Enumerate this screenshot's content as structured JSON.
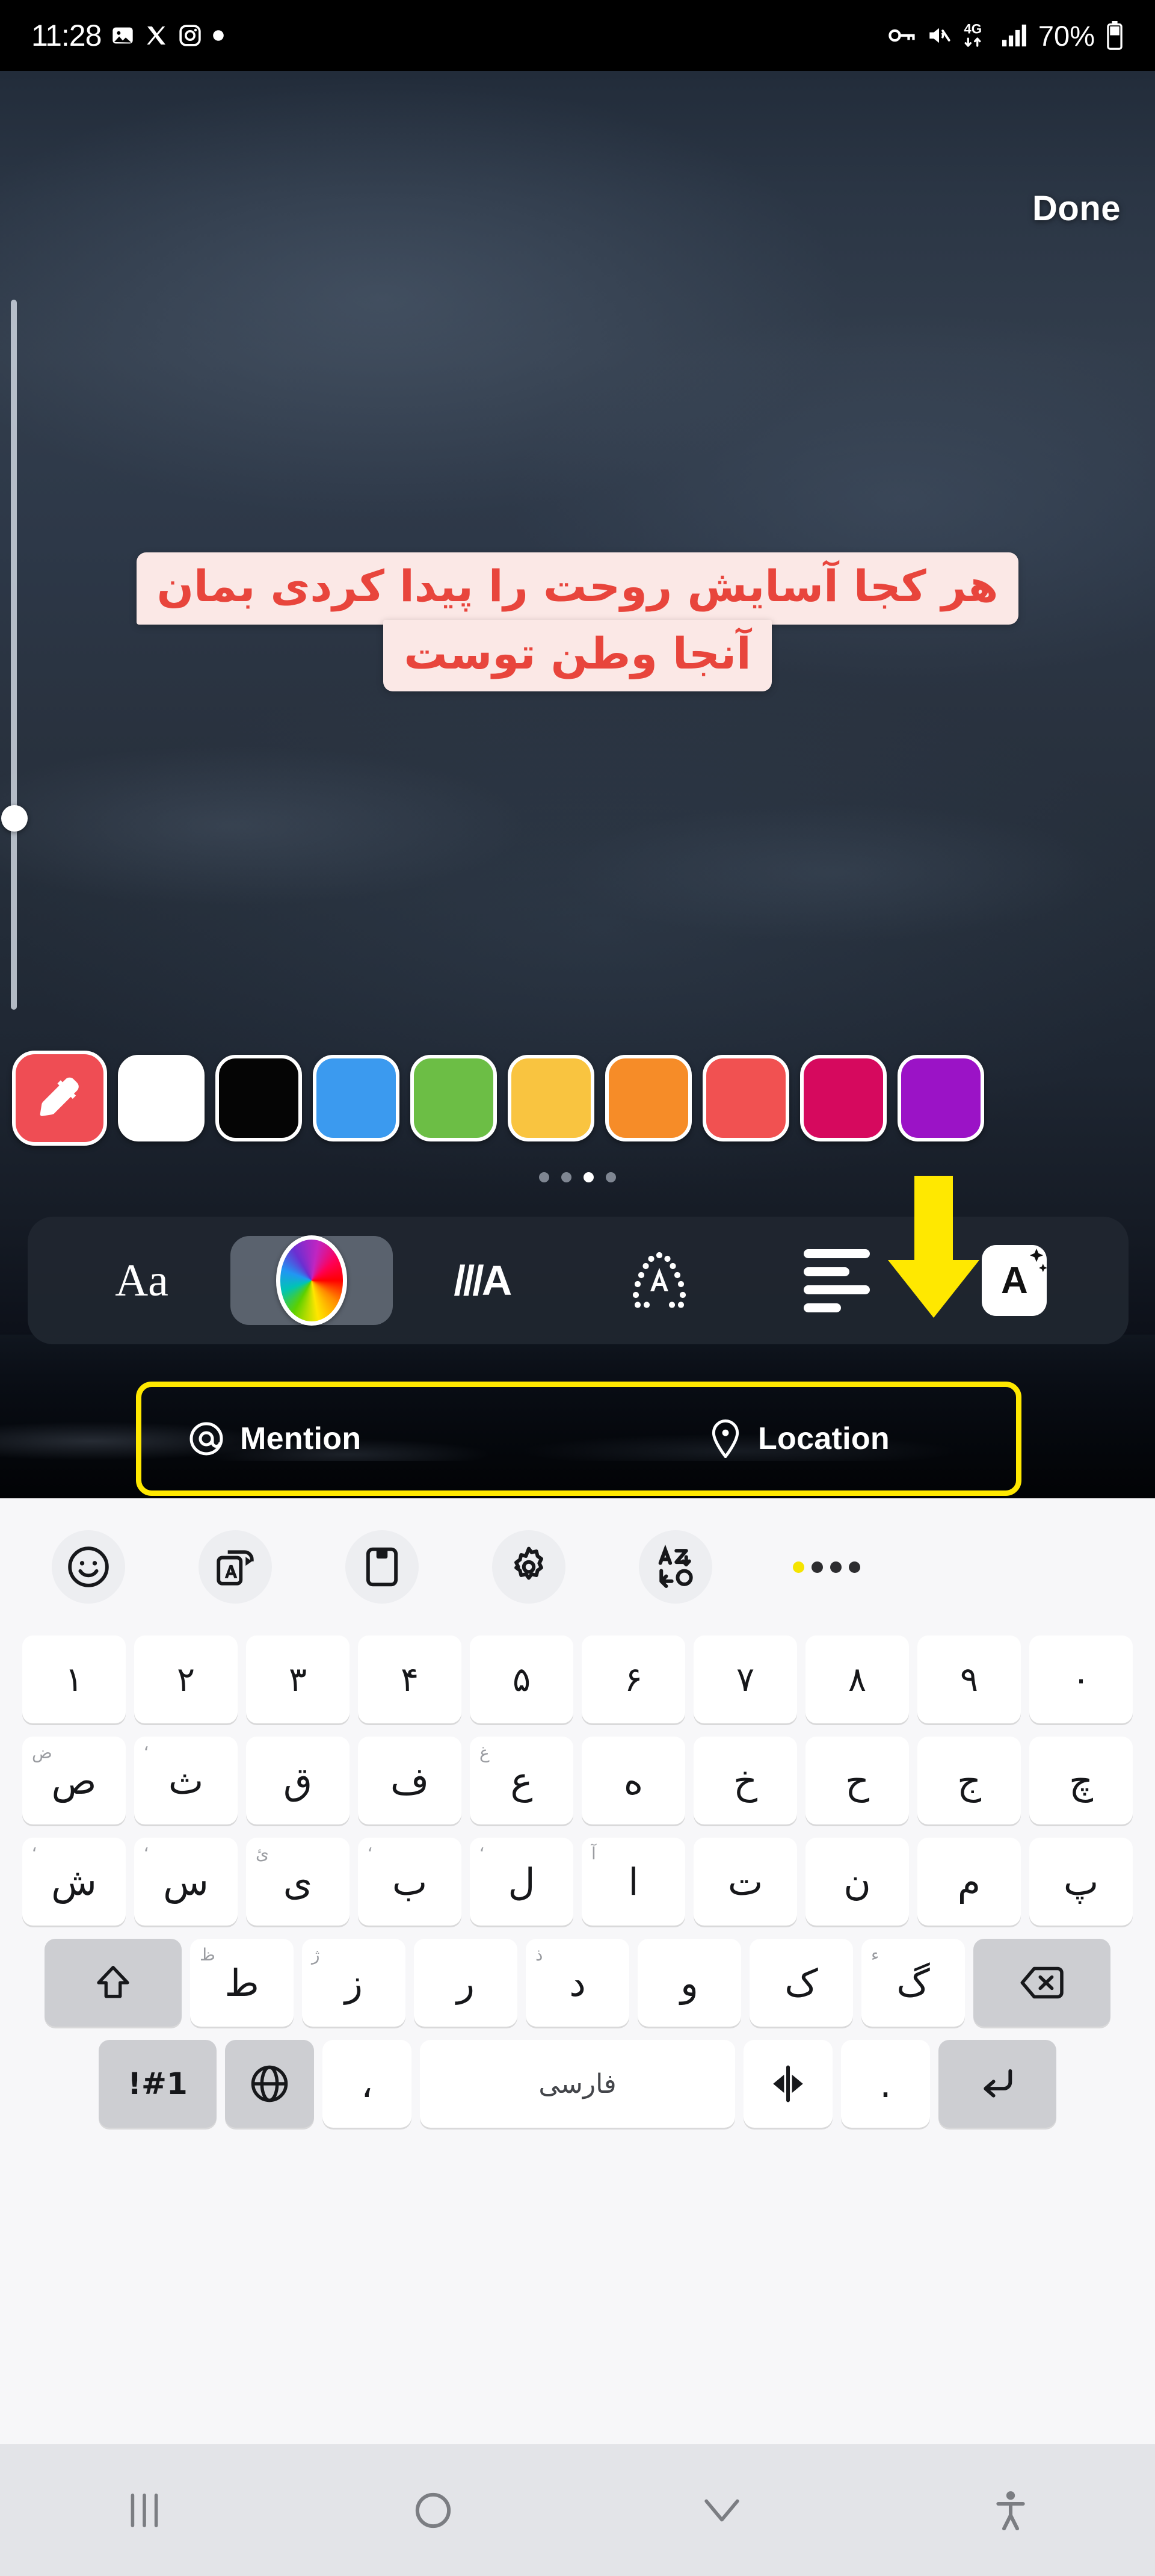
{
  "status_bar": {
    "time": "11:28",
    "left_icons": [
      "photos-icon",
      "x-app-icon",
      "instagram-icon",
      "dot-indicator-icon"
    ],
    "right_icons": [
      "vpn-key-icon",
      "mute-icon",
      "network-4g-icon",
      "signal-bars-icon"
    ],
    "battery_percent": "70%"
  },
  "editor": {
    "done_label": "Done",
    "sticker_text": {
      "line1": "هر کجا آسایش روحت را پیدا کردی بمان",
      "line2": "آنجا وطن توست",
      "text_color": "#e8453c",
      "background_color": "#fbe8e6"
    },
    "size_slider": {
      "name": "text-size-slider",
      "handle_position_percent": 72
    }
  },
  "color_palette": {
    "eyedropper": {
      "name": "eyedropper",
      "background": "#ef4d54"
    },
    "swatches": [
      {
        "name": "white",
        "hex": "#ffffff"
      },
      {
        "name": "black",
        "hex": "#050505"
      },
      {
        "name": "blue",
        "hex": "#3b9aef"
      },
      {
        "name": "green",
        "hex": "#6cbe45"
      },
      {
        "name": "amber",
        "hex": "#f9c440"
      },
      {
        "name": "orange",
        "hex": "#f68c28"
      },
      {
        "name": "coral",
        "hex": "#f15151"
      },
      {
        "name": "magenta",
        "hex": "#d6095e"
      },
      {
        "name": "purple",
        "hex": "#9b13c6"
      }
    ],
    "page_dots": {
      "count": 4,
      "active_index": 2
    }
  },
  "style_toolbar": {
    "items": [
      {
        "name": "font-style",
        "glyph": "Aa",
        "selected": false
      },
      {
        "name": "text-color",
        "glyph": "",
        "selected": true
      },
      {
        "name": "text-effect",
        "glyph": "///A",
        "selected": false
      },
      {
        "name": "text-animation",
        "glyph": "A",
        "selected": false
      },
      {
        "name": "text-alignment",
        "glyph": "",
        "selected": false
      },
      {
        "name": "ai-text",
        "glyph": "A",
        "selected": false
      }
    ],
    "annotation": {
      "name": "yellow-down-arrow",
      "color": "#ffe800"
    }
  },
  "mention_location": {
    "mention_label": "Mention",
    "mention_icon": "at-icon",
    "location_label": "Location",
    "location_icon": "map-pin-icon",
    "highlight_color": "#ffe800"
  },
  "keyboard": {
    "toolbar_icons": [
      "emoji-icon",
      "translate-icon",
      "clipboard-icon",
      "settings-gear-icon",
      "text-mode-switch-icon",
      "more-options-icon"
    ],
    "rows": [
      {
        "name": "number-row",
        "keys": [
          {
            "label": "۱"
          },
          {
            "label": "۲"
          },
          {
            "label": "۳"
          },
          {
            "label": "۴"
          },
          {
            "label": "۵"
          },
          {
            "label": "۶"
          },
          {
            "label": "۷"
          },
          {
            "label": "۸"
          },
          {
            "label": "۹"
          },
          {
            "label": "۰"
          }
        ]
      },
      {
        "name": "letter-row-1",
        "keys": [
          {
            "label": "ص",
            "hint": "ض"
          },
          {
            "label": "ث",
            "hint": "‘"
          },
          {
            "label": "ق"
          },
          {
            "label": "ف"
          },
          {
            "label": "ع",
            "hint": "غ"
          },
          {
            "label": "ه"
          },
          {
            "label": "خ"
          },
          {
            "label": "ح"
          },
          {
            "label": "ج"
          },
          {
            "label": "چ"
          }
        ]
      },
      {
        "name": "letter-row-2",
        "keys": [
          {
            "label": "ش",
            "hint": "‘"
          },
          {
            "label": "س",
            "hint": "‘"
          },
          {
            "label": "ی",
            "hint": "ئ"
          },
          {
            "label": "ب",
            "hint": "‘"
          },
          {
            "label": "ل",
            "hint": "‘"
          },
          {
            "label": "ا",
            "hint": "آ"
          },
          {
            "label": "ت"
          },
          {
            "label": "ن"
          },
          {
            "label": "م"
          },
          {
            "label": "پ"
          }
        ]
      },
      {
        "name": "letter-row-3",
        "keys": [
          {
            "label": "ط",
            "hint": "ظ"
          },
          {
            "label": "ز",
            "hint": "ژ"
          },
          {
            "label": "ر"
          },
          {
            "label": "د",
            "hint": "ذ"
          },
          {
            "label": "و"
          },
          {
            "label": "ک"
          },
          {
            "label": "گ",
            "hint": "ء"
          }
        ]
      }
    ],
    "shift_key": "shift-icon",
    "backspace_key": "backspace-icon",
    "bottom_row": {
      "symbols_label": "!#1",
      "globe_label": "globe-icon",
      "comma_label": "،",
      "space_label": "فارسی",
      "direction_label": "text-direction-icon",
      "period_label": ".",
      "enter_label": "enter-icon"
    }
  },
  "nav_bar": {
    "buttons": [
      "recents-icon",
      "home-icon",
      "hide-keyboard-icon",
      "accessibility-icon"
    ]
  }
}
